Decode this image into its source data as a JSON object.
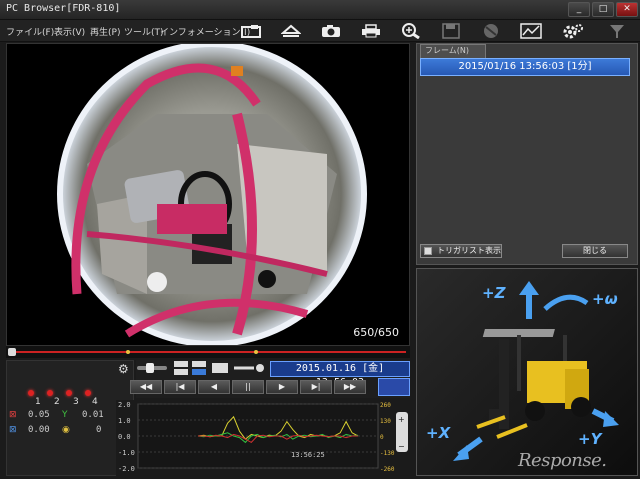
{
  "window": {
    "title": "PC Browser[FDR-810]",
    "min": "_",
    "max": "□",
    "close": "✕"
  },
  "menu": {
    "items": [
      "ファイル(F)",
      "表示(V)",
      "再生(P)",
      "ツール(T)",
      "インフォメーション(I)"
    ]
  },
  "toolbar": {
    "icons": [
      "open-folder-icon",
      "eject-icon",
      "camera-icon",
      "print-icon",
      "zoom-icon",
      "save-icon",
      "disabled-icon",
      "map-icon",
      "settings-icon",
      "filter-icon"
    ]
  },
  "video": {
    "frame_counter": "650/650"
  },
  "sensors": {
    "leds": [
      "1",
      "2",
      "3",
      "4"
    ],
    "row1_left": "0.05",
    "row1_right": "0.01",
    "row2_left": "0.00",
    "row2_right": "0"
  },
  "playback": {
    "datetime": "2015.01.16 [金] 13:56:03",
    "buttons": [
      "◀◀",
      "|◀",
      "◀",
      "||",
      "▶",
      "▶|",
      "▶▶"
    ]
  },
  "chart_data": {
    "type": "line",
    "ylim": [
      -2.0,
      2.0
    ],
    "yticks": [
      "2.0",
      "1.0",
      "0.0",
      "-1.0",
      "-2.0"
    ],
    "right_ticks": [
      "260",
      "130",
      "0",
      "-130",
      "-260"
    ],
    "time_label": "13:56:25",
    "series": [
      {
        "color": "#d8d030",
        "values": [
          0.0,
          0.05,
          -0.05,
          0.02,
          0.0,
          0.8,
          1.2,
          0.3,
          -0.2,
          0.1,
          0.0,
          -0.1,
          0.05,
          0.0,
          0.3,
          0.9,
          0.4,
          0.0,
          -0.1,
          0.1,
          0.0,
          0.05,
          -0.05,
          0.0,
          0.2,
          0.9,
          0.2,
          0.0
        ]
      },
      {
        "color": "#30c040",
        "values": [
          0.0,
          -0.05,
          0.05,
          0.0,
          0.1,
          0.2,
          0.0,
          -0.1,
          -0.4,
          0.0,
          0.1,
          -0.1,
          0.0,
          0.05,
          -0.05,
          0.1,
          -0.2,
          0.0,
          0.05,
          -0.05,
          0.0,
          0.1,
          -0.1,
          0.0,
          -0.1,
          0.1,
          0.0,
          0.05
        ]
      },
      {
        "color": "#d03030",
        "values": [
          0.0,
          0.0,
          -0.05,
          0.05,
          0.0,
          -0.1,
          0.1,
          0.0,
          -0.2,
          -0.4,
          0.0,
          0.05,
          -0.05,
          0.0,
          0.0,
          -0.2,
          0.0,
          0.05,
          -0.05,
          0.0,
          0.05,
          0.0,
          -0.05,
          0.0,
          0.0,
          -0.1,
          0.0,
          0.0
        ]
      }
    ]
  },
  "right_panel": {
    "tab": "フレーム(N)",
    "list_item": "2015/01/16 13:56:03 [1分]",
    "trigger_label": "トリガリスト表示",
    "close_label": "閉じる"
  },
  "axes": {
    "z": "+Z",
    "omega": "+ω",
    "x": "+X",
    "y": "+Y"
  },
  "watermark": "Response."
}
